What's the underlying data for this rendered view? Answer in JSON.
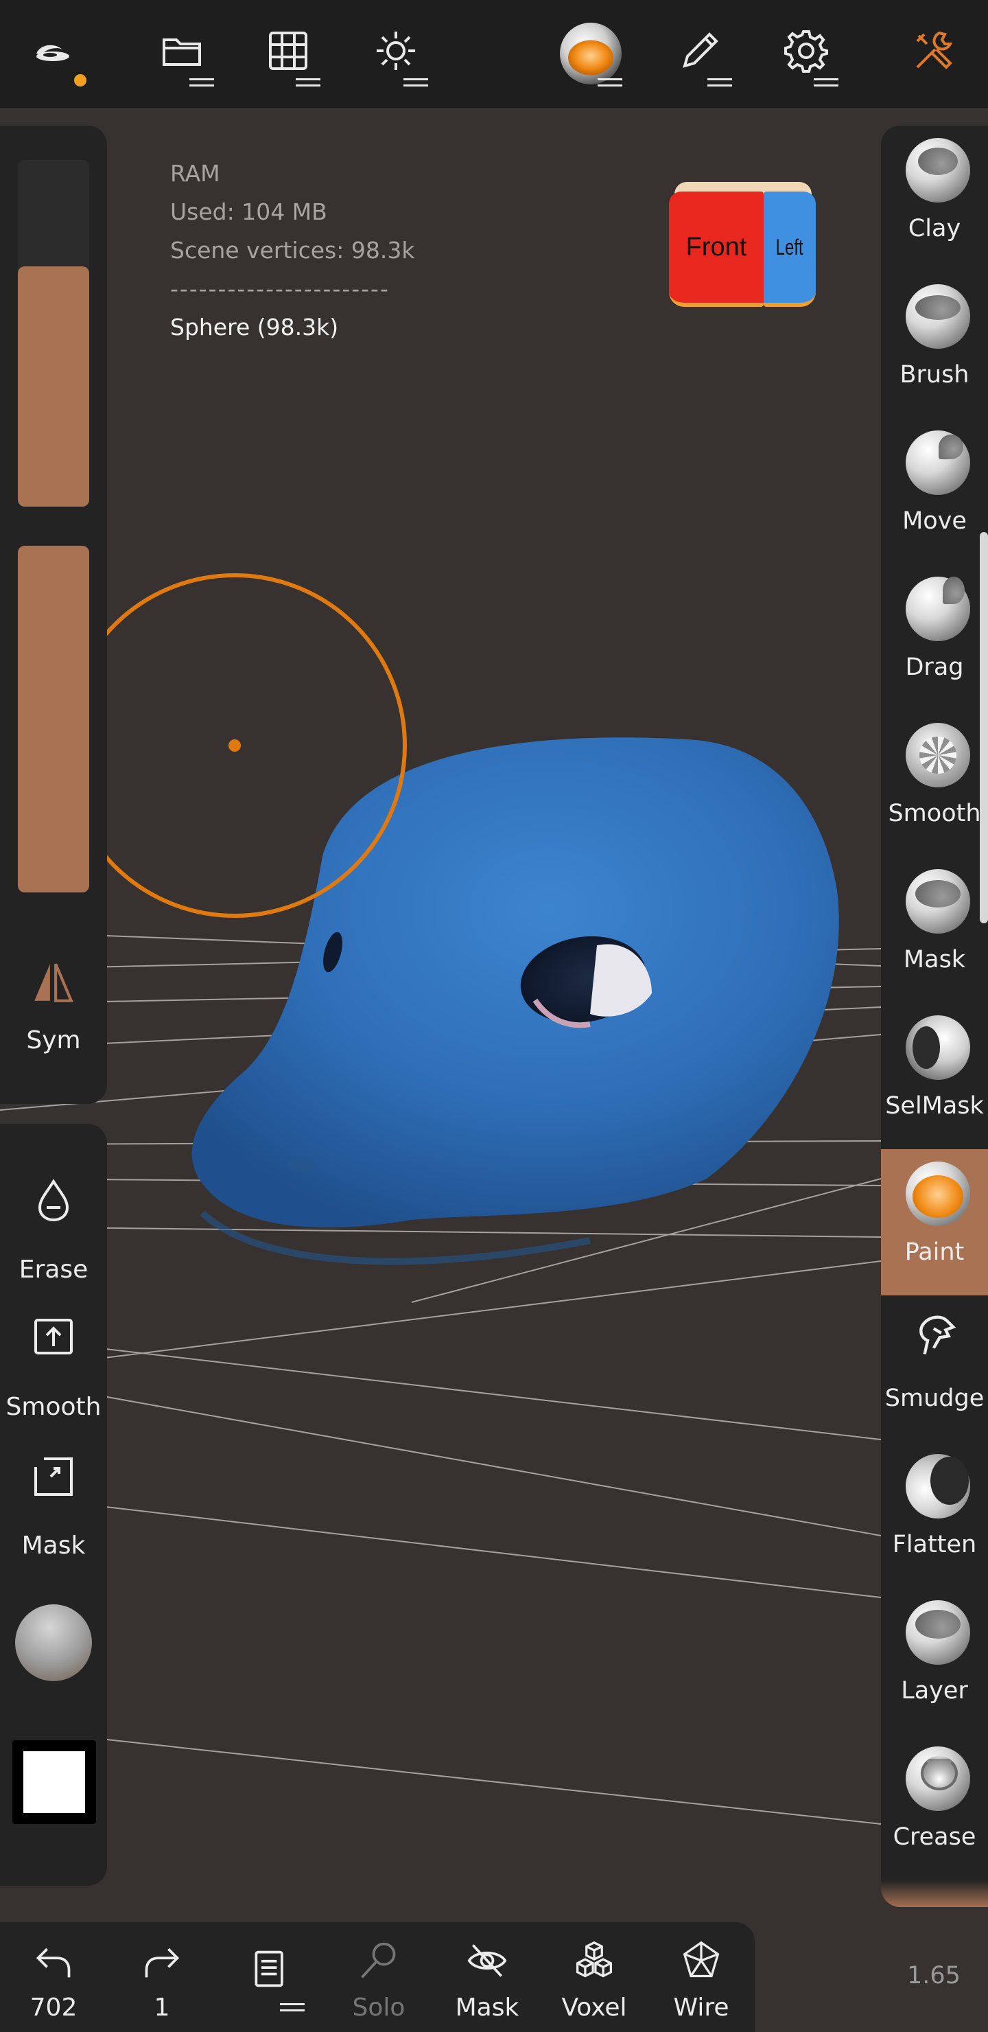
{
  "top_bar": {
    "items": [
      "app-logo",
      "files",
      "scene",
      "lighting",
      "material",
      "painting",
      "settings",
      "tools"
    ]
  },
  "stats": {
    "ram_label": "RAM",
    "used": "Used: 104 MB",
    "vertices": "Scene vertices: 98.3k",
    "separator": "-----------------------",
    "mesh": "Sphere (98.3k)"
  },
  "view_cube": {
    "front": "Front",
    "left": "Left"
  },
  "left_panel": {
    "sym": "Sym",
    "erase": "Erase",
    "smooth": "Smooth",
    "mask": "Mask"
  },
  "tools": [
    {
      "label": "Clay"
    },
    {
      "label": "Brush"
    },
    {
      "label": "Move"
    },
    {
      "label": "Drag"
    },
    {
      "label": "Smooth"
    },
    {
      "label": "Mask"
    },
    {
      "label": "SelMask"
    },
    {
      "label": "Paint"
    },
    {
      "label": "Smudge"
    },
    {
      "label": "Flatten"
    },
    {
      "label": "Layer"
    },
    {
      "label": "Crease"
    }
  ],
  "active_tool": "Paint",
  "bottom_bar": {
    "undo": "702",
    "redo": "1",
    "solo": "Solo",
    "mask": "Mask",
    "voxel": "Voxel",
    "wire": "Wire"
  },
  "version": "1.65",
  "colors": {
    "accent": "#a87253",
    "brush_ring": "#e07a10",
    "model": "#2f6fb8",
    "background": "#37322f",
    "panel": "#232323"
  }
}
